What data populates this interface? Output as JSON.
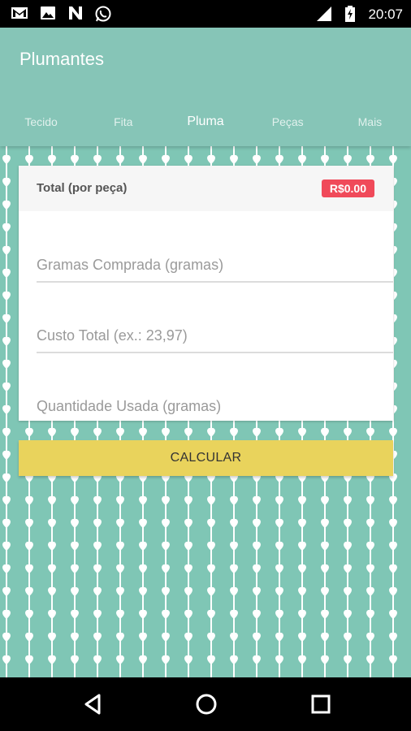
{
  "status_bar": {
    "time": "20:07",
    "icons": [
      "gmail-icon",
      "image-icon",
      "n-app-icon",
      "whatsapp-icon",
      "signal-icon",
      "battery-charging-icon"
    ]
  },
  "app": {
    "title": "Plumantes",
    "colors": {
      "primary": "#86c5b7",
      "accent_button": "#e9d35c",
      "badge": "#f04a5a"
    }
  },
  "tabs": [
    {
      "label": "Tecido",
      "active": false
    },
    {
      "label": "Fita",
      "active": false
    },
    {
      "label": "Pluma",
      "active": true
    },
    {
      "label": "Peças",
      "active": false
    },
    {
      "label": "Mais",
      "active": false
    }
  ],
  "card": {
    "total_label": "Total (por peça)",
    "total_value": "R$0.00",
    "fields": [
      {
        "placeholder": "Gramas Comprada (gramas)",
        "value": ""
      },
      {
        "placeholder": "Custo Total (ex.: 23,97)",
        "value": ""
      },
      {
        "placeholder": "Quantidade Usada (gramas)",
        "value": ""
      }
    ]
  },
  "calculate_button": {
    "label": "CALCULAR"
  },
  "nav": {
    "icons": [
      "back-icon",
      "home-icon",
      "recents-icon"
    ]
  }
}
